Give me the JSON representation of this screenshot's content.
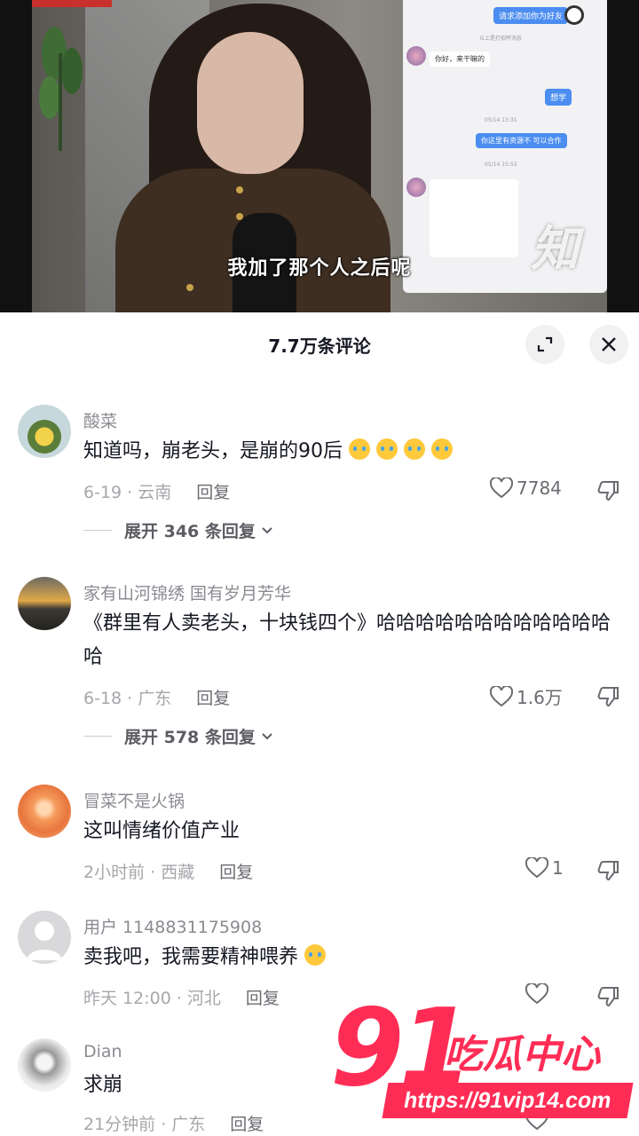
{
  "video": {
    "subtitle": "我加了那个人之后呢",
    "phone": {
      "bubble1": "请求添加你为好友",
      "note1": "以上是打招呼消息",
      "bubble2": "你好，来干嘛的",
      "bubble3": "想学",
      "time1": "05/14 13:31",
      "bubble4": "你这里有资源不 可以合作",
      "time2": "05/14 15:53"
    },
    "watermark": "知"
  },
  "comments_panel": {
    "title": "7.7万条评论",
    "colors": {
      "accent": "#ff2d55",
      "text": "#161823",
      "muted": "#8a8b91"
    },
    "comments": [
      {
        "name": "酸菜",
        "text": "知道吗，崩老头，是崩的90后",
        "date_location": "6-19 · 云南",
        "reply": "回复",
        "likes": "7784",
        "expand": "展开 346 条回复",
        "emoji": "crying-face-icon"
      },
      {
        "name": "家有山河锦绣  国有岁月芳华",
        "text": "《群里有人卖老头，十块钱四个》哈哈哈哈哈哈哈哈哈哈哈哈哈",
        "date_location": "6-18 · 广东",
        "reply": "回复",
        "likes": "1.6万",
        "expand": "展开 578 条回复"
      },
      {
        "name": "冒菜不是火锅",
        "text": "这叫情绪价值产业",
        "date_location": "2小时前 · 西藏",
        "reply": "回复",
        "likes": "1"
      },
      {
        "name": "用户 1148831175908",
        "text": "卖我吧，我需要精神喂养",
        "date_location": "昨天 12:00 · 河北",
        "reply": "回复",
        "likes": "",
        "emoji": "thinking-face-icon"
      },
      {
        "name": "Dian",
        "text": "求崩",
        "date_location": "21分钟前 · 广东",
        "reply": "回复",
        "likes": ""
      }
    ]
  },
  "watermark_logo": {
    "number": "91",
    "name": "吃瓜中心",
    "url": "https://91vip14.com"
  }
}
